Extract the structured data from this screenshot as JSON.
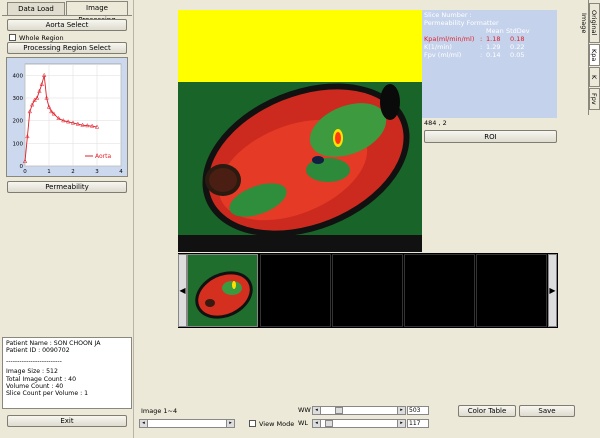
{
  "tabs": {
    "data_load": "Data Load",
    "image_processing": "Image Processing"
  },
  "left": {
    "aorta_select": "Aorta Select",
    "whole_region": "Whole Region",
    "processing_region_select": "Processing Region Select",
    "permeability": "Permeability",
    "exit": "Exit"
  },
  "chart_data": {
    "type": "line",
    "series": [
      {
        "name": "Aorta",
        "x": [
          0,
          0.1,
          0.2,
          0.3,
          0.4,
          0.5,
          0.6,
          0.7,
          0.8,
          0.9,
          1.0,
          1.1,
          1.2,
          1.4,
          1.6,
          1.8,
          2.0,
          2.2,
          2.4,
          2.6,
          2.8,
          3.0
        ],
        "y": [
          20,
          130,
          240,
          270,
          290,
          300,
          330,
          360,
          400,
          300,
          260,
          240,
          230,
          210,
          200,
          195,
          190,
          185,
          180,
          178,
          176,
          172
        ]
      }
    ],
    "xticks": [
      "0",
      "1",
      "2",
      "3",
      "4"
    ],
    "yticks": [
      "0",
      "100",
      "200",
      "300",
      "400"
    ],
    "xlim": [
      0,
      4
    ],
    "ylim": [
      0,
      450
    ],
    "legend_position": "bottom-right",
    "color": "#e0202a"
  },
  "patient": {
    "name": "Patient Name : SON CHOON JA",
    "id": "Patient ID : 0090702",
    "divider": "-------------------------",
    "image_size": "Image Size : 512",
    "total_count": "Total Image Count : 40",
    "volume_count": "Volume Count : 40",
    "slice_count": "Slice Count per Volume : 1"
  },
  "overlay": {
    "slice_number": "Slice Number :",
    "formatter": "Permeability Formatter",
    "header_mean": "Mean",
    "header_stddev": "StdDev",
    "kpa_label": "Kpa(ml/min/ml)",
    "kpa_colon": ":",
    "kpa_mean": "1.18",
    "kpa_std": "0.18",
    "kep_label": "K(1/min)",
    "kep_colon": ":",
    "kep_mean": "1.29",
    "kep_std": "0.22",
    "fpv_label": "Fpv (ml/ml)",
    "fpv_colon": ":",
    "fpv_mean": "0.14",
    "fpv_std": "0.05"
  },
  "coord": "484 , 2",
  "roi_button": "ROI",
  "right_tabs": [
    "Original Image",
    "Kpa",
    "K",
    "Fpv"
  ],
  "bottom": {
    "image_range": "Image 1~4",
    "view_mode": "View Mode",
    "ww_label": "WW",
    "wl_label": "WL",
    "ww_value": "503",
    "wl_value": "117",
    "color_table": "Color Table",
    "save": "Save"
  },
  "colors": {
    "overlay_bg": "#c5d2ec",
    "yellow": "#ffff00",
    "green": "#2f9b3f",
    "red": "#e0202a"
  }
}
